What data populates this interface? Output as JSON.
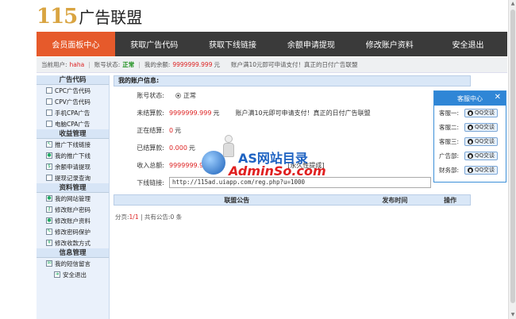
{
  "logo": {
    "num": "115",
    "text": "广告联盟"
  },
  "nav": [
    {
      "label": "会员面板中心",
      "active": true
    },
    {
      "label": "获取广告代码"
    },
    {
      "label": "获取下线链接"
    },
    {
      "label": "余额申请提现"
    },
    {
      "label": "修改账户资料"
    },
    {
      "label": "安全退出"
    }
  ],
  "infobar": {
    "user_label": "当前用户:",
    "user": "haha",
    "status_label": "账号状态:",
    "status": "正常",
    "balance_label": "我的余额:",
    "balance": "9999999.999",
    "unit": "元",
    "notice": "账户满10元即可申请支付！真正的日付广告联盟"
  },
  "sidebar": {
    "sections": [
      {
        "title": "广告代码",
        "items": [
          "CPC广告代码",
          "CPV广告代码",
          "手机CPA广告",
          "电脑CPA广告"
        ]
      },
      {
        "title": "收益管理",
        "items": [
          "推广下线链接",
          "我的推广下线",
          "余额申请提现",
          "提现记录查询"
        ]
      },
      {
        "title": "资料管理",
        "items": [
          "我的网站管理",
          "修改账户密码",
          "修改账户资料",
          "修改密码保护",
          "修改收款方式"
        ]
      },
      {
        "title": "信息管理",
        "items": [
          "我的短信留言",
          "安全退出"
        ]
      }
    ]
  },
  "account": {
    "title": "我的账户信息:",
    "status_label": "账号状态:",
    "status": "正常",
    "unsettled_label": "未结算款:",
    "unsettled": "9999999.999",
    "unit": "元",
    "notice": "账户满10元即可申请支付！真正的日付广告联盟",
    "settling_label": "正在结算:",
    "settling": "0",
    "settled_label": "已结算款:",
    "settled": "0.000",
    "income_label": "收入总额:",
    "income": "9999999.9",
    "income_note": "[永久性提成]",
    "link_label": "下线链接:",
    "link": "http://115ad.uiapp.com/reg.php?u=1000"
  },
  "table": {
    "col_title": "联盟公告",
    "col_time": "发布时间",
    "col_op": "操作"
  },
  "pager": {
    "prefix": "分页:",
    "page": "1/1",
    "sep": "| 共有公告:",
    "count": "0",
    "suffix": "条"
  },
  "support": {
    "title": "客服中心",
    "rows": [
      {
        "label": "客服一:",
        "btn": "QQ交谈"
      },
      {
        "label": "客服二:",
        "btn": "QQ交谈"
      },
      {
        "label": "客服三:",
        "btn": "QQ交谈"
      },
      {
        "label": "广告部:",
        "btn": "QQ交谈"
      },
      {
        "label": "财务部:",
        "btn": "QQ交谈"
      }
    ]
  },
  "watermark": {
    "line1": "AS网站目录",
    "line2": "AdminSo.com"
  },
  "colors": {
    "nav_active": "#e65a2b",
    "nav_bg": "#3a3a3a",
    "accent_blue": "#2f86d6",
    "red": "#d22222",
    "green": "#1a8f1a"
  }
}
